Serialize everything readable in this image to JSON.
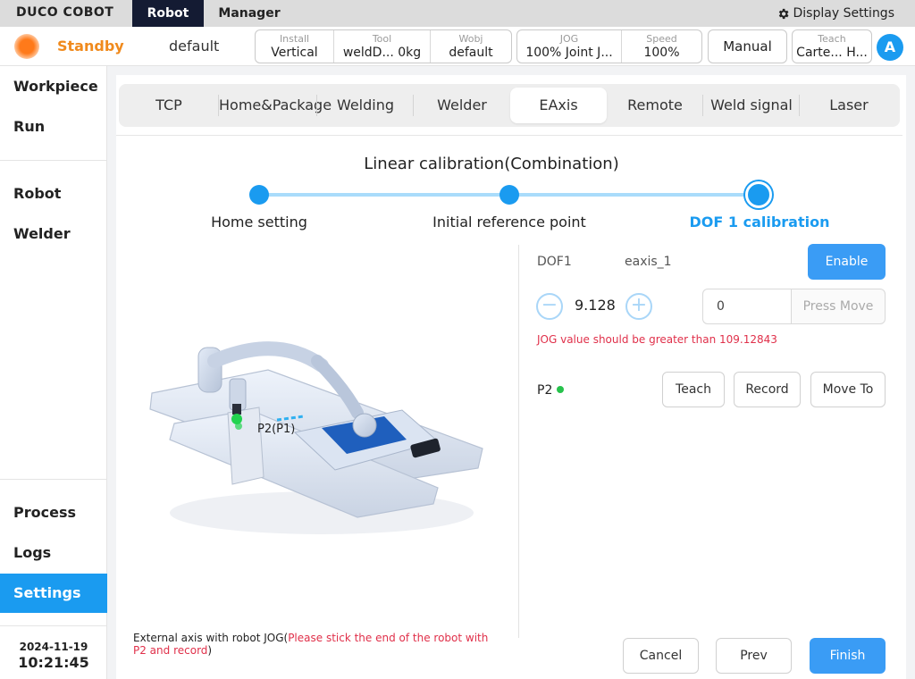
{
  "topbar": {
    "logo": "DUCO COBOT",
    "tabs": [
      "Robot",
      "Manager"
    ],
    "display_settings": "Display Settings",
    "display_settings_icon": "gear-icon"
  },
  "status": {
    "state": "Standby",
    "state_color": "#f08a1d",
    "project": "default",
    "install_label": "Install",
    "install_value": "Vertical",
    "tool_label": "Tool",
    "tool_value": "weldD...",
    "tool_weight": "0kg",
    "wobj_label": "Wobj",
    "wobj_value": "default",
    "jog_label": "JOG",
    "jog_value": "100% Joint J...",
    "speed_label": "Speed",
    "speed_value": "100%",
    "mode_button": "Manual",
    "teach_label": "Teach",
    "teach_value": "Carte...",
    "teach_value2": "H...",
    "avatar": "A"
  },
  "sidebar": {
    "items": [
      "Workpiece",
      "Run",
      "Robot",
      "Welder",
      "Process",
      "Logs",
      "Settings"
    ],
    "active": "Settings",
    "date": "2024-11-19",
    "time": "10:21:45"
  },
  "tabs": {
    "items": [
      "TCP",
      "Home&Package",
      "Welding",
      "Welder",
      "EAxis",
      "Remote",
      "Weld signal",
      "Laser"
    ],
    "active": "EAxis"
  },
  "calibration": {
    "title": "Linear calibration(Combination)",
    "steps": [
      "Home setting",
      "Initial reference point",
      "DOF 1 calibration"
    ],
    "current_step": 2,
    "illustration_label": "P2(P1)",
    "note_prefix": "External axis with robot JOG(",
    "note_highlight": "Please stick the end of the robot with P2 and record",
    "note_suffix": ")"
  },
  "dof": {
    "name": "DOF1",
    "axis": "eaxis_1",
    "enable_button": "Enable",
    "jog_value": "9.128",
    "move_input_value": "0",
    "press_move": "Press Move",
    "warning": "JOG value should be greater than 109.12843",
    "point_name": "P2",
    "point_status_color": "#27c24c",
    "teach_button": "Teach",
    "record_button": "Record",
    "move_to_button": "Move To"
  },
  "footer": {
    "cancel": "Cancel",
    "prev": "Prev",
    "finish": "Finish"
  },
  "colors": {
    "accent": "#1a9bf0",
    "warning": "#e0304a",
    "topbar_active": "#141b33"
  }
}
